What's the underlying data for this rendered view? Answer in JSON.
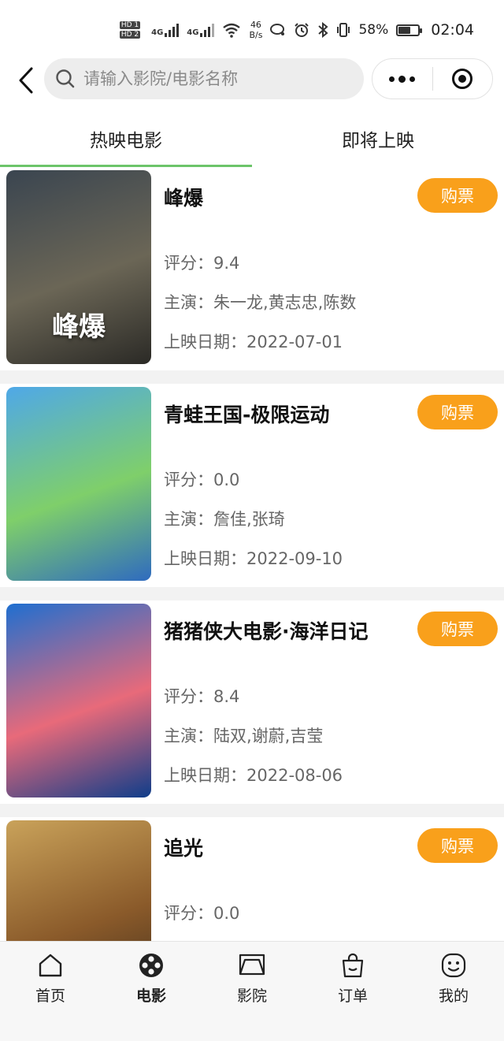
{
  "status_bar": {
    "hd1": "HD 1",
    "hd2": "HD 2",
    "net1": "4G",
    "net2": "4G",
    "speed_value": "46",
    "speed_unit": "B/s",
    "battery": "58%",
    "battery_level": 0.58,
    "time": "02:04"
  },
  "search": {
    "placeholder": "请输入影院/电影名称",
    "value": ""
  },
  "tabs": [
    {
      "label": "热映电影",
      "active": true
    },
    {
      "label": "即将上映",
      "active": false
    }
  ],
  "labels": {
    "rating": "评分：",
    "cast": "主演：",
    "release": "上映日期："
  },
  "buy_label": "购票",
  "movies": [
    {
      "name": "峰爆",
      "rating": "9.4",
      "cast": "朱一龙,黄志忠,陈数",
      "release_date": "2022-07-01",
      "poster_text": "峰爆",
      "poster_colors": [
        "#3a4550",
        "#6b6656",
        "#2b2a26"
      ]
    },
    {
      "name": "青蛙王国-极限运动",
      "rating": "0.0",
      "cast": "詹佳,张琦",
      "release_date": "2022-09-10",
      "poster_text": "",
      "poster_colors": [
        "#4fa8e8",
        "#7fcf6a",
        "#2f6bbf"
      ]
    },
    {
      "name": "猪猪侠大电影·海洋日记",
      "rating": "8.4",
      "cast": "陆双,谢蔚,吉莹",
      "release_date": "2022-08-06",
      "poster_text": "",
      "poster_colors": [
        "#1f6fd0",
        "#e86a7a",
        "#0f3d8a"
      ]
    },
    {
      "name": "追光",
      "rating": "0.0",
      "cast": "",
      "release_date": "",
      "poster_text": "",
      "poster_colors": [
        "#c9a25a",
        "#8a5a2a",
        "#3a2a1a"
      ]
    }
  ],
  "bottom_nav": [
    {
      "label": "首页",
      "icon": "home-icon",
      "active": false
    },
    {
      "label": "电影",
      "icon": "film-reel-icon",
      "active": true
    },
    {
      "label": "影院",
      "icon": "cinema-screen-icon",
      "active": false
    },
    {
      "label": "订单",
      "icon": "shopping-bag-icon",
      "active": false
    },
    {
      "label": "我的",
      "icon": "smiley-face-icon",
      "active": false
    }
  ],
  "colors": {
    "accent_green": "#6cc46a",
    "buy_orange": "#f9a01b"
  }
}
